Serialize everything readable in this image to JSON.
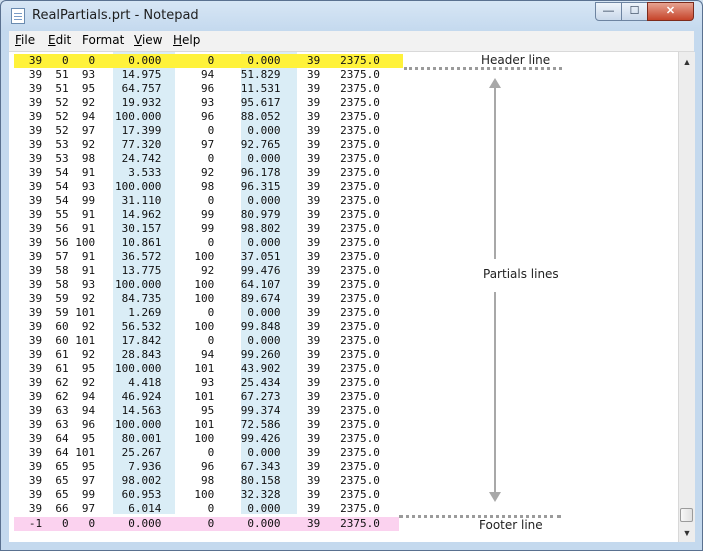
{
  "window": {
    "title": "RealPartials.prt - Notepad"
  },
  "menu": [
    {
      "key": "F",
      "rest": "ile"
    },
    {
      "key": "E",
      "rest": "dit"
    },
    {
      "key": "",
      "rest": "Format"
    },
    {
      "key": "V",
      "rest": "iew"
    },
    {
      "key": "H",
      "rest": "elp"
    }
  ],
  "controls": {
    "minimize": "—",
    "maximize": "☐",
    "close": "✕"
  },
  "file": {
    "header": [
      "39",
      "0",
      "0",
      "0.000",
      "0",
      "0.000",
      "39",
      "2375.0"
    ],
    "rows": [
      [
        "39",
        "51",
        "93",
        "14.975",
        "94",
        "51.829",
        "39",
        "2375.0"
      ],
      [
        "39",
        "51",
        "95",
        "64.757",
        "96",
        "11.531",
        "39",
        "2375.0"
      ],
      [
        "39",
        "52",
        "92",
        "19.932",
        "93",
        "95.617",
        "39",
        "2375.0"
      ],
      [
        "39",
        "52",
        "94",
        "100.000",
        "96",
        "88.052",
        "39",
        "2375.0"
      ],
      [
        "39",
        "52",
        "97",
        "17.399",
        "0",
        "0.000",
        "39",
        "2375.0"
      ],
      [
        "39",
        "53",
        "92",
        "77.320",
        "97",
        "92.765",
        "39",
        "2375.0"
      ],
      [
        "39",
        "53",
        "98",
        "24.742",
        "0",
        "0.000",
        "39",
        "2375.0"
      ],
      [
        "39",
        "54",
        "91",
        "3.533",
        "92",
        "96.178",
        "39",
        "2375.0"
      ],
      [
        "39",
        "54",
        "93",
        "100.000",
        "98",
        "96.315",
        "39",
        "2375.0"
      ],
      [
        "39",
        "54",
        "99",
        "31.110",
        "0",
        "0.000",
        "39",
        "2375.0"
      ],
      [
        "39",
        "55",
        "91",
        "14.962",
        "99",
        "80.979",
        "39",
        "2375.0"
      ],
      [
        "39",
        "56",
        "91",
        "30.157",
        "99",
        "98.802",
        "39",
        "2375.0"
      ],
      [
        "39",
        "56",
        "100",
        "10.861",
        "0",
        "0.000",
        "39",
        "2375.0"
      ],
      [
        "39",
        "57",
        "91",
        "36.572",
        "100",
        "37.051",
        "39",
        "2375.0"
      ],
      [
        "39",
        "58",
        "91",
        "13.775",
        "92",
        "99.476",
        "39",
        "2375.0"
      ],
      [
        "39",
        "58",
        "93",
        "100.000",
        "100",
        "64.107",
        "39",
        "2375.0"
      ],
      [
        "39",
        "59",
        "92",
        "84.735",
        "100",
        "89.674",
        "39",
        "2375.0"
      ],
      [
        "39",
        "59",
        "101",
        "1.269",
        "0",
        "0.000",
        "39",
        "2375.0"
      ],
      [
        "39",
        "60",
        "92",
        "56.532",
        "100",
        "99.848",
        "39",
        "2375.0"
      ],
      [
        "39",
        "60",
        "101",
        "17.842",
        "0",
        "0.000",
        "39",
        "2375.0"
      ],
      [
        "39",
        "61",
        "92",
        "28.843",
        "94",
        "99.260",
        "39",
        "2375.0"
      ],
      [
        "39",
        "61",
        "95",
        "100.000",
        "101",
        "43.902",
        "39",
        "2375.0"
      ],
      [
        "39",
        "62",
        "92",
        "4.418",
        "93",
        "25.434",
        "39",
        "2375.0"
      ],
      [
        "39",
        "62",
        "94",
        "46.924",
        "101",
        "67.273",
        "39",
        "2375.0"
      ],
      [
        "39",
        "63",
        "94",
        "14.563",
        "95",
        "99.374",
        "39",
        "2375.0"
      ],
      [
        "39",
        "63",
        "96",
        "100.000",
        "101",
        "72.586",
        "39",
        "2375.0"
      ],
      [
        "39",
        "64",
        "95",
        "80.001",
        "100",
        "99.426",
        "39",
        "2375.0"
      ],
      [
        "39",
        "64",
        "101",
        "25.267",
        "0",
        "0.000",
        "39",
        "2375.0"
      ],
      [
        "39",
        "65",
        "95",
        "7.936",
        "96",
        "67.343",
        "39",
        "2375.0"
      ],
      [
        "39",
        "65",
        "97",
        "98.002",
        "98",
        "80.158",
        "39",
        "2375.0"
      ],
      [
        "39",
        "65",
        "99",
        "60.953",
        "100",
        "32.328",
        "39",
        "2375.0"
      ],
      [
        "39",
        "66",
        "97",
        "6.014",
        "0",
        "0.000",
        "39",
        "2375.0"
      ]
    ],
    "footer": [
      "-1",
      "0",
      "0",
      "0.000",
      "0",
      "0.000",
      "39",
      "2375.0"
    ]
  },
  "annotations": {
    "header": "Header line",
    "partials": "Partials lines",
    "footer": "Footer line"
  },
  "colors": {
    "header_highlight": "#fff23a",
    "footer_highlight": "#fbd2ef",
    "column_band": "#daedf6"
  }
}
